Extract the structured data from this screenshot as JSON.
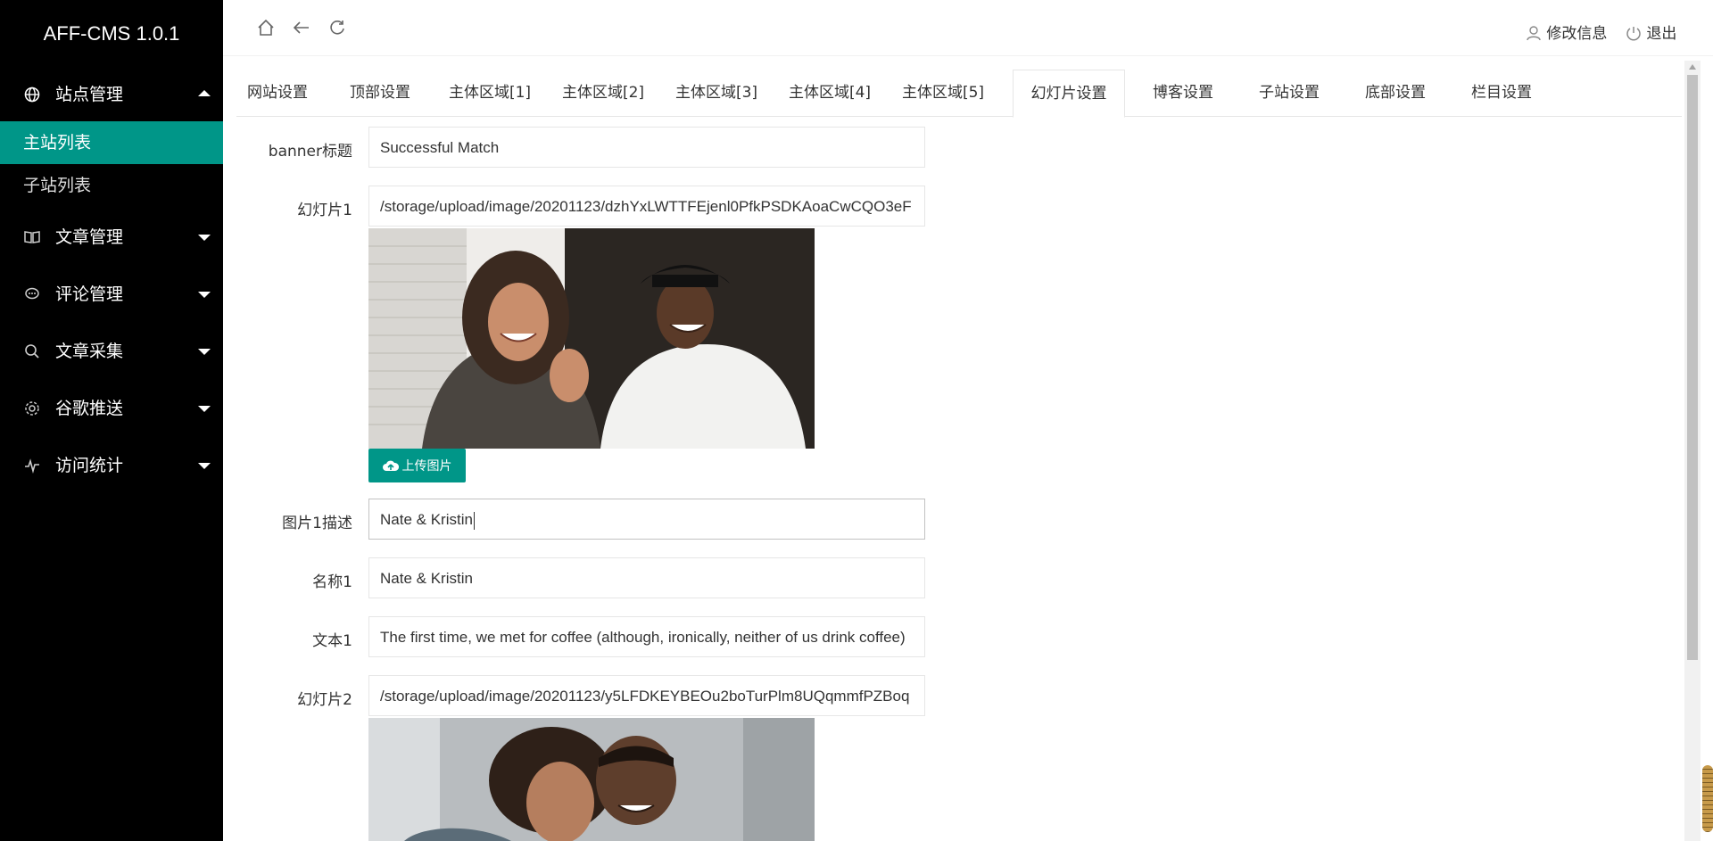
{
  "app": {
    "title": "AFF-CMS 1.0.1"
  },
  "sidebar": {
    "groups": [
      {
        "label": "站点管理",
        "icon": "globe-icon",
        "expanded": true,
        "items": [
          {
            "label": "主站列表",
            "active": true
          },
          {
            "label": "子站列表",
            "active": false
          }
        ]
      },
      {
        "label": "文章管理",
        "icon": "book-icon",
        "expanded": false
      },
      {
        "label": "评论管理",
        "icon": "comment-icon",
        "expanded": false
      },
      {
        "label": "文章采集",
        "icon": "search-icon",
        "expanded": false
      },
      {
        "label": "谷歌推送",
        "icon": "cog-icon",
        "expanded": false
      },
      {
        "label": "访问统计",
        "icon": "pulse-icon",
        "expanded": false
      }
    ]
  },
  "topbar": {
    "icons": [
      "home-icon",
      "back-arrow-icon",
      "refresh-icon"
    ],
    "edit_profile": "修改信息",
    "logout": "退出"
  },
  "tabs": [
    {
      "label": "网站设置",
      "active": false
    },
    {
      "label": "顶部设置",
      "active": false
    },
    {
      "label": "主体区域[1]",
      "active": false
    },
    {
      "label": "主体区域[2]",
      "active": false
    },
    {
      "label": "主体区域[3]",
      "active": false
    },
    {
      "label": "主体区域[4]",
      "active": false
    },
    {
      "label": "主体区域[5]",
      "active": false
    },
    {
      "label": "幻灯片设置",
      "active": true
    },
    {
      "label": "博客设置",
      "active": false
    },
    {
      "label": "子站设置",
      "active": false
    },
    {
      "label": "底部设置",
      "active": false
    },
    {
      "label": "栏目设置",
      "active": false
    }
  ],
  "form": {
    "banner_title": {
      "label": "banner标题",
      "value": "Successful Match"
    },
    "slide1": {
      "label": "幻灯片1",
      "value": "/storage/upload/image/20201123/dzhYxLWTTFEjenl0PfkPSDKAoaCwCQO3eF"
    },
    "upload_label": "上传图片",
    "image1_desc": {
      "label": "图片1描述",
      "value": "Nate & Kristin"
    },
    "name1": {
      "label": "名称1",
      "value": "Nate & Kristin"
    },
    "text1": {
      "label": "文本1",
      "value": "The first time, we met for coffee (although, ironically, neither of us drink coffee)"
    },
    "slide2": {
      "label": "幻灯片2",
      "value": "/storage/upload/image/20201123/y5LFDKEYBEOu2boTurPlm8UQqmmfPZBoq"
    }
  },
  "colors": {
    "accent": "#009688",
    "sidebar_bg": "#000000"
  }
}
